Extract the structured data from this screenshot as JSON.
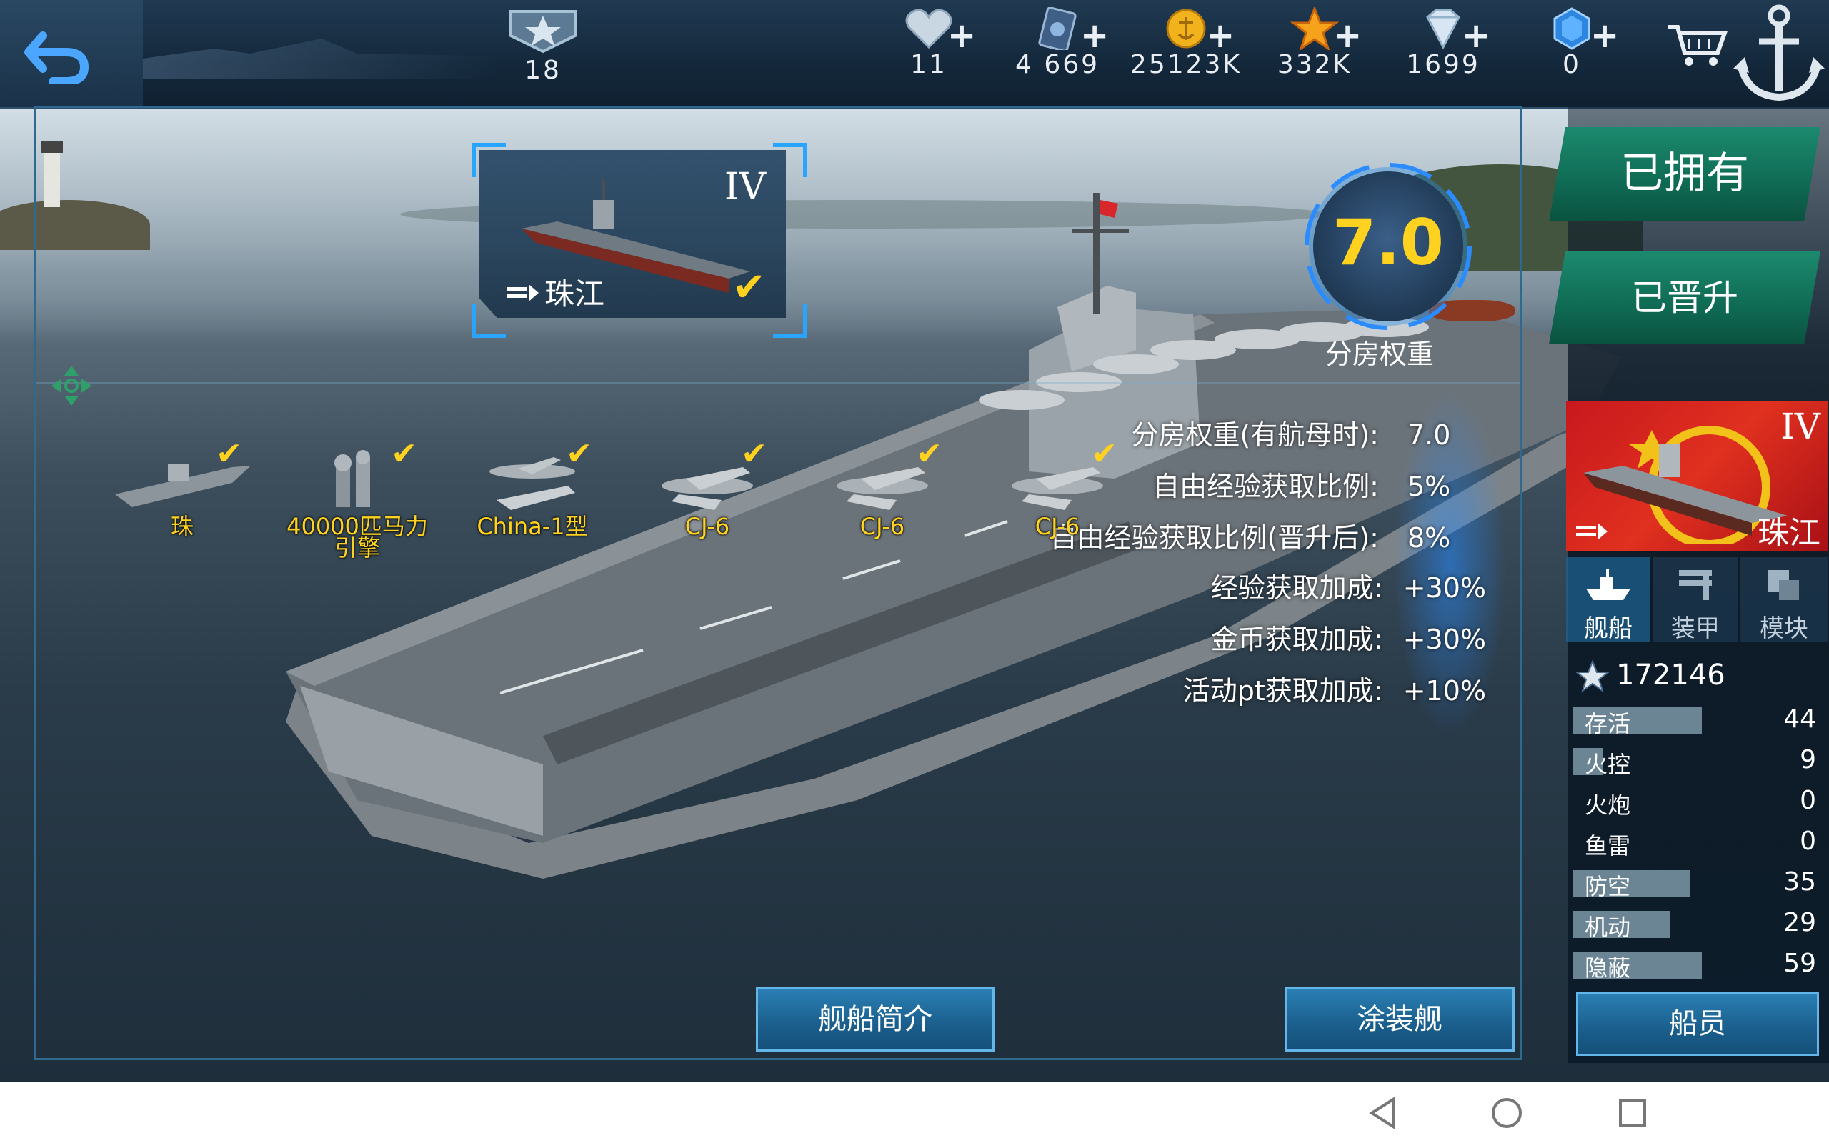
{
  "topbar": {
    "level": "18",
    "resources": [
      {
        "name": "heart",
        "value": "11"
      },
      {
        "name": "card",
        "value": "4 669"
      },
      {
        "name": "gold",
        "value": "25123K"
      },
      {
        "name": "star",
        "value": "332K"
      },
      {
        "name": "diamond",
        "value": "1699"
      },
      {
        "name": "crystal",
        "value": "0"
      }
    ],
    "plus": "+"
  },
  "ship_card": {
    "tier": "IV",
    "name": "珠江"
  },
  "rating": {
    "value": "7.0",
    "label": "分房权重"
  },
  "stats": [
    {
      "label": "分房权重(有航母时):",
      "value": "7.0"
    },
    {
      "label": "自由经验获取比例:",
      "value": "5%"
    },
    {
      "label": "自由经验获取比例(晋升后):",
      "value": "8%"
    },
    {
      "label": "经验获取加成:",
      "value": "+30%"
    },
    {
      "label": "金币获取加成:",
      "value": "+30%"
    },
    {
      "label": "活动pt获取加成:",
      "value": "+10%"
    }
  ],
  "equipment": [
    {
      "label": "珠"
    },
    {
      "label": "40000匹马力",
      "label2": "引擎"
    },
    {
      "label": "China-1型"
    },
    {
      "label": "CJ-6"
    },
    {
      "label": "CJ-6"
    },
    {
      "label": "CJ-6"
    }
  ],
  "buttons": {
    "intro": "舰船简介",
    "skin": "涂装舰",
    "owned": "已拥有",
    "promoted": "已晋升",
    "crew": "船员"
  },
  "right_panel": {
    "tier": "IV",
    "ship_name": "珠江",
    "tabs": [
      "舰船",
      "装甲",
      "模块"
    ],
    "power": "172146",
    "attributes": [
      {
        "name": "存活",
        "value": "44",
        "level": 0.44
      },
      {
        "name": "火控",
        "value": "9",
        "level": 0.09
      },
      {
        "name": "火炮",
        "value": "0",
        "level": 0
      },
      {
        "name": "鱼雷",
        "value": "0",
        "level": 0
      },
      {
        "name": "防空",
        "value": "35",
        "level": 0.35
      },
      {
        "name": "机动",
        "value": "29",
        "level": 0.29
      },
      {
        "name": "隐蔽",
        "value": "59",
        "level": 0.59
      }
    ]
  },
  "colors": {
    "accent": "#ffd21f",
    "frame": "#2e6a90",
    "green_button": "#0f6a54",
    "blue_button": "#1a5e8c"
  }
}
